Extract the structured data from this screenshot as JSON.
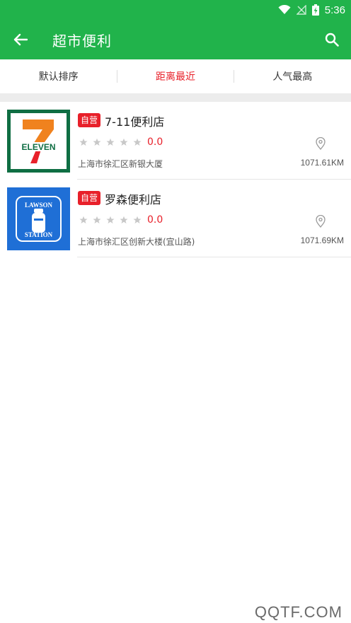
{
  "status_bar": {
    "time": "5:36"
  },
  "toolbar": {
    "title": "超市便利"
  },
  "tabs": [
    {
      "label": "默认排序",
      "active": false
    },
    {
      "label": "距离最近",
      "active": true
    },
    {
      "label": "人气最高",
      "active": false
    }
  ],
  "stores": [
    {
      "badge": "自营",
      "name": "7-11便利店",
      "rating": "0.0",
      "stars_filled": 0,
      "stars_total": 5,
      "address": "上海市徐汇区新银大厦",
      "distance": "1071.61KM",
      "logo_text": "ELEVEN"
    },
    {
      "badge": "自营",
      "name": "罗森便利店",
      "rating": "0.0",
      "stars_filled": 0,
      "stars_total": 5,
      "address": "上海市徐汇区创新大楼(宜山路)",
      "distance": "1071.69KM",
      "logo_text_top": "LAWSON",
      "logo_text_bottom": "STATION"
    }
  ],
  "watermark": "QQTF.COM",
  "colors": {
    "primary_green": "#21b34b",
    "accent_red": "#e8202a",
    "star_gray": "#c8c8c8",
    "lawson_blue": "#1f6fd6"
  }
}
